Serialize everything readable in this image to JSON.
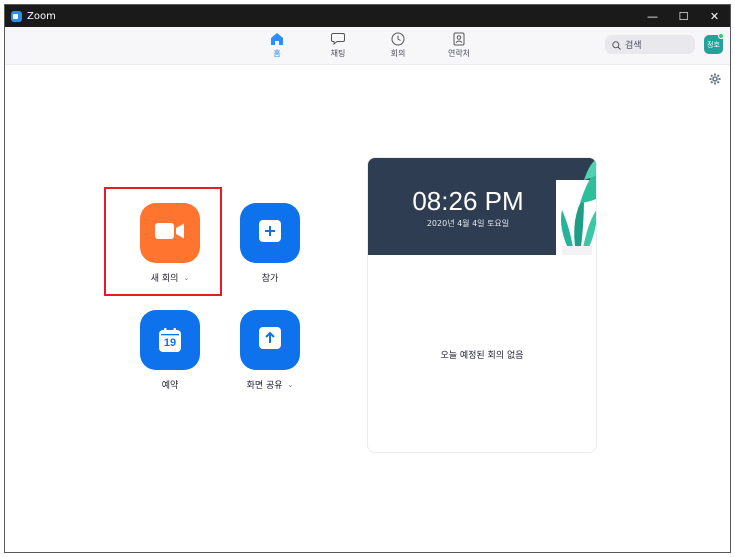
{
  "window": {
    "title": "Zoom"
  },
  "titlebar": {
    "minimize": "—",
    "maximize": "☐",
    "close": "✕"
  },
  "nav": {
    "tabs": [
      {
        "label": "홈",
        "icon": "home-icon",
        "active": true
      },
      {
        "label": "채팅",
        "icon": "chat-icon",
        "active": false
      },
      {
        "label": "회의",
        "icon": "clock-icon",
        "active": false
      },
      {
        "label": "연락처",
        "icon": "contacts-icon",
        "active": false
      }
    ]
  },
  "search": {
    "placeholder": "검색"
  },
  "user": {
    "avatar_text": "정호"
  },
  "actions": {
    "new_meeting": {
      "label": "새 회의",
      "icon": "video-camera-icon",
      "color": "#ff742e"
    },
    "join": {
      "label": "참가",
      "icon": "plus-icon",
      "color": "#0e72ed"
    },
    "schedule": {
      "label": "예약",
      "icon": "calendar-icon",
      "day": "19",
      "color": "#0e72ed"
    },
    "share_screen": {
      "label": "화면 공유",
      "icon": "share-arrow-icon",
      "color": "#0e72ed"
    }
  },
  "clock": {
    "time": "08:26 PM",
    "date": "2020년 4월 4일 토요일"
  },
  "meetings": {
    "empty_message": "오늘 예정된 회의 없음"
  },
  "colors": {
    "accent": "#2d8cff",
    "header_bg": "#2e3d52",
    "highlight": "#e02020"
  }
}
